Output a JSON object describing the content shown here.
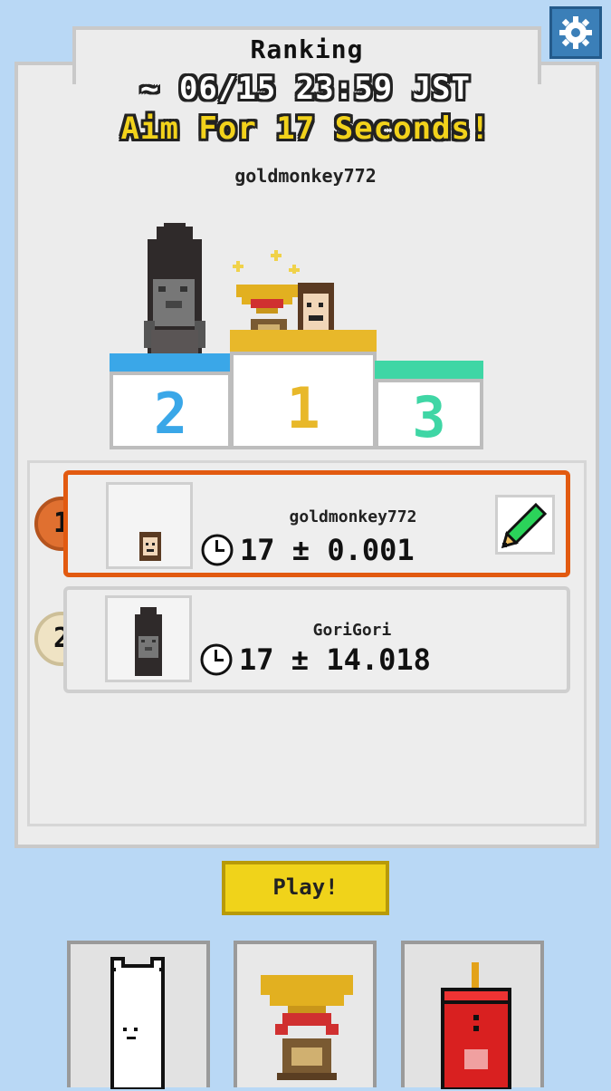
{
  "header": {
    "title": "Ranking",
    "deadline": "~ 06/15 23:59 JST",
    "goal": "Aim For 17 Seconds!",
    "leader_name": "goldmonkey772"
  },
  "podium": {
    "second_label": "2",
    "first_label": "1",
    "third_label": "3"
  },
  "ranking": [
    {
      "rank": "1",
      "name": "goldmonkey772",
      "target": "17",
      "pm": "±",
      "diff": "0.001"
    },
    {
      "rank": "2",
      "name": "GoriGori",
      "target": "17",
      "pm": "±",
      "diff": "14.018"
    }
  ],
  "actions": {
    "play_label": "Play!"
  },
  "tabs": [
    {
      "icon": "cat-character-icon"
    },
    {
      "icon": "trophy-icon"
    },
    {
      "icon": "juice-can-icon"
    }
  ],
  "colors": {
    "background": "#b9d8f5",
    "accent_yellow": "#f2d21b",
    "first_place_orange": "#e25a10",
    "second_blue": "#3aa7e8",
    "third_green": "#3fd6a5",
    "gold": "#e8b82a"
  }
}
